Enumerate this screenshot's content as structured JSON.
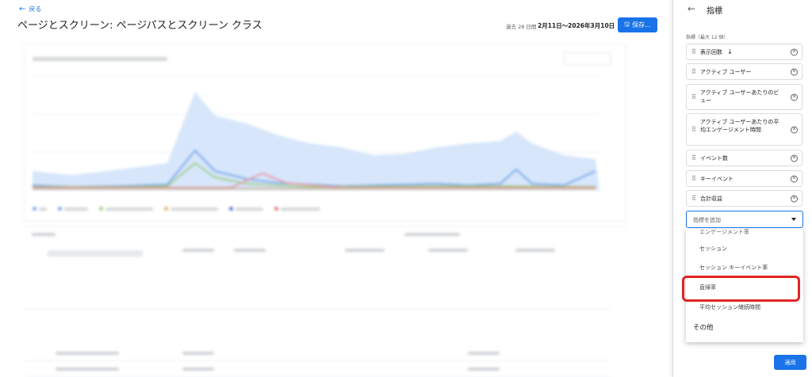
{
  "header": {
    "back_label": "戻る",
    "title": "ページとスクリーン: ページパスとスクリーン クラス",
    "date_prefix": "過去 28 日間",
    "date_range": "2月11日～2026年3月10日",
    "save_label": "保存..."
  },
  "panel": {
    "title": "指標",
    "subtitle": "指標（最大 12 個）",
    "metrics": [
      {
        "label": "表示回数",
        "sorted": true
      },
      {
        "label": "アクティブ ユーザー"
      },
      {
        "label": "アクティブ ユーザーあたりのビュー"
      },
      {
        "label": "アクティブ ユーザーあたりの平均エンゲージメント時間"
      },
      {
        "label": "イベント数"
      },
      {
        "label": "キーイベント"
      },
      {
        "label": "合計収益"
      }
    ],
    "add_placeholder": "指標を追加",
    "dropdown": {
      "cut_item": "エンゲージメント率",
      "items": [
        "セッション",
        "セッション キーイベント率",
        "直帰率",
        "平均セッション継続時間"
      ],
      "group_label": "その他",
      "highlighted": "直帰率"
    },
    "apply_label": "適用"
  },
  "colors": {
    "accent": "#1a73e8",
    "highlight": "#e02424"
  }
}
